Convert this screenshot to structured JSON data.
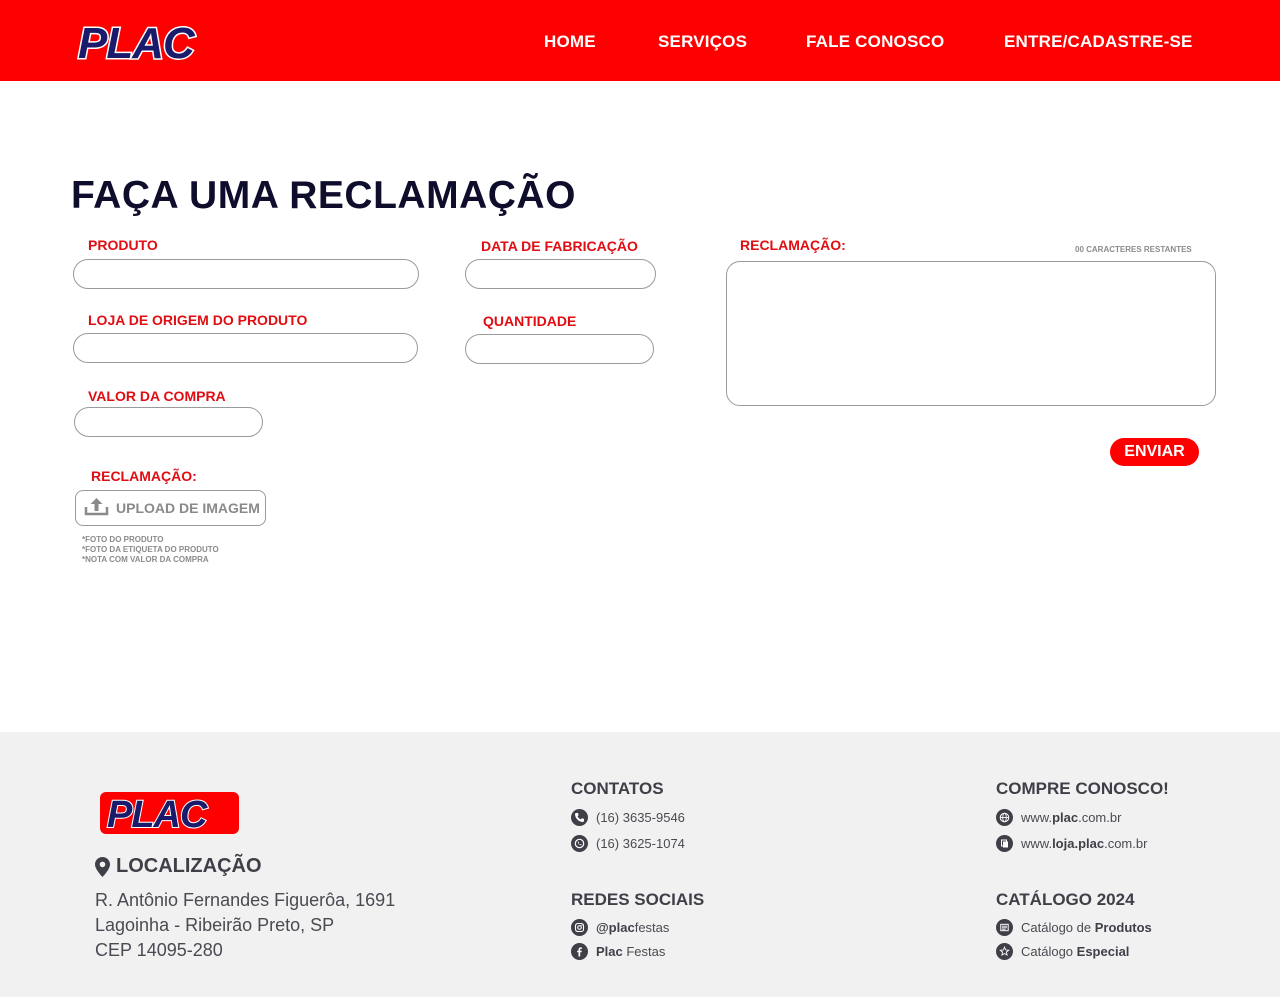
{
  "header": {
    "logo_text": "PLAC",
    "nav": [
      "HOME",
      "SERVIÇOS",
      "FALE CONOSCO",
      "ENTRE/CADASTRE-SE"
    ]
  },
  "form": {
    "title": "FAÇA UMA RECLAMAÇÃO",
    "labels": {
      "produto": "PRODUTO",
      "data_fabricacao": "DATA DE FABRICAÇÃO",
      "loja_origem": "LOJA DE ORIGEM DO PRODUTO",
      "quantidade": "QUANTIDADE",
      "valor_compra": "VALOR DA COMPRA",
      "reclamacao_upload": "RECLAMAÇÃO:",
      "reclamacao_text": "RECLAMAÇÃO:"
    },
    "chars_remaining": "00 CARACTERES RESTANTES",
    "upload_label": "UPLOAD DE IMAGEM",
    "notes": [
      "*FOTO DO PRODUTO",
      "*FOTO DA ETIQUETA DO PRODUTO",
      "*NOTA COM VALOR DA COMPRA"
    ],
    "submit_label": "ENVIAR"
  },
  "footer": {
    "logo_text": "PLAC",
    "location_title": "LOCALIZAÇÃO",
    "address": [
      "R. Antônio Fernandes Figuerôa, 1691",
      "Lagoinha - Ribeirão Preto, SP",
      "CEP 14095-280"
    ],
    "contacts_title": "CONTATOS",
    "phone": "(16) 3635-9546",
    "whatsapp": "(16) 3625-1074",
    "social_title": "REDES SOCIAIS",
    "instagram_bold": "@plac",
    "instagram_rest": "festas",
    "facebook_bold": "Plac",
    "facebook_rest": " Festas",
    "buy_title": "COMPRE CONOSCO!",
    "site_pre": "www.",
    "site_bold": "plac",
    "site_post": ".com.br",
    "store_pre": "www.",
    "store_bold": "loja.plac",
    "store_post": ".com.br",
    "catalog_title": "CATÁLOGO 2024",
    "catalog1_pre": "Catálogo de ",
    "catalog1_bold": "Produtos",
    "catalog2_pre": "Catálogo ",
    "catalog2_bold": "Especial"
  },
  "colors": {
    "brand_red": "#ff0000",
    "logo_navy": "#1b1b6b",
    "title_navy": "#0e0d2b",
    "label_red": "#e00d12"
  },
  "icons": [
    "phone-icon",
    "whatsapp-icon",
    "instagram-icon",
    "facebook-icon",
    "globe-icon",
    "store-icon",
    "catalog-icon",
    "star-icon",
    "location-pin-icon",
    "upload-icon"
  ]
}
